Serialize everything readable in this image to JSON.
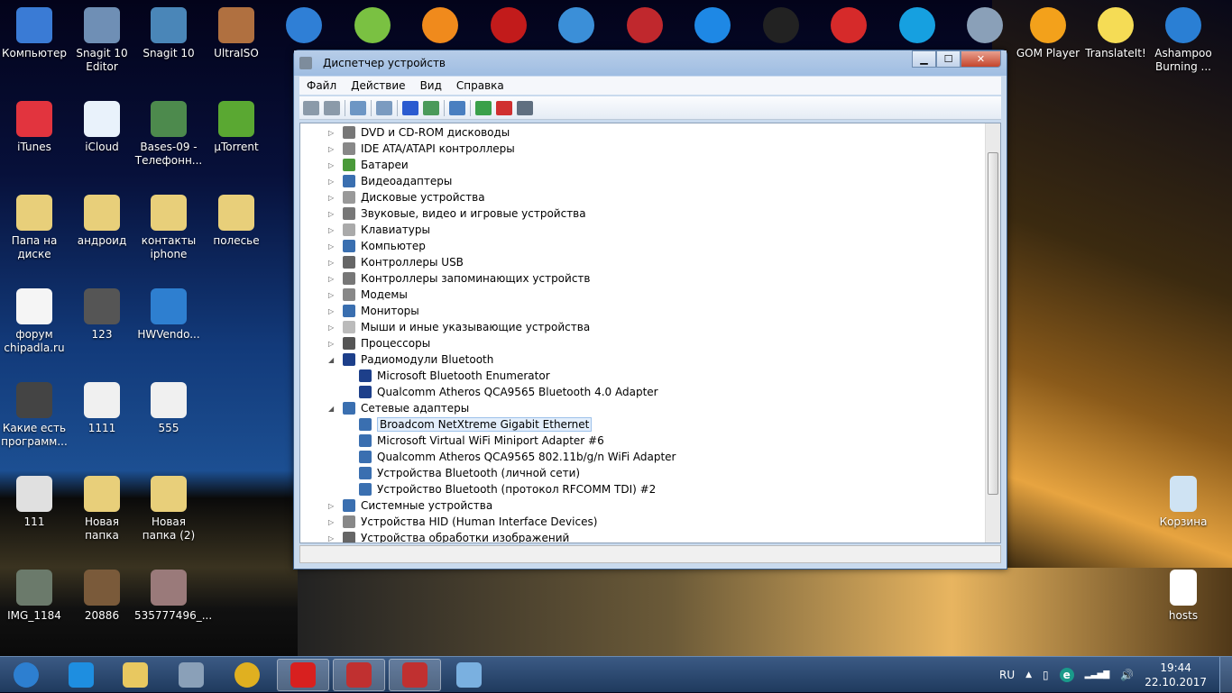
{
  "desktop": {
    "icons": [
      {
        "label": "Компьютер",
        "color": "#3a7bd5",
        "col": 0,
        "row": 0
      },
      {
        "label": "Snagit 10 Editor",
        "color": "#6f8fb5",
        "col": 1,
        "row": 0
      },
      {
        "label": "Snagit 10",
        "color": "#4a86b8",
        "col": 2,
        "row": 0
      },
      {
        "label": "UltraISO",
        "color": "#b07040",
        "col": 3,
        "row": 0
      },
      {
        "label": "iTunes",
        "color": "#e2343e",
        "col": 0,
        "row": 1
      },
      {
        "label": "iCloud",
        "color": "#e9f2fb",
        "col": 1,
        "row": 1
      },
      {
        "label": "Bases-09 - Телефонн...",
        "color": "#4d8a4d",
        "col": 2,
        "row": 1
      },
      {
        "label": "µTorrent",
        "color": "#5aa832",
        "col": 3,
        "row": 1
      },
      {
        "label": "Папа на диске",
        "color": "#e8cf7a",
        "col": 0,
        "row": 2
      },
      {
        "label": "андроид",
        "color": "#e8cf7a",
        "col": 1,
        "row": 2
      },
      {
        "label": "контакты iphone",
        "color": "#e8cf7a",
        "col": 2,
        "row": 2
      },
      {
        "label": "полесье",
        "color": "#e8cf7a",
        "col": 3,
        "row": 2
      },
      {
        "label": "форум chipadla.ru",
        "color": "#f5f5f5",
        "col": 0,
        "row": 3
      },
      {
        "label": "123",
        "color": "#555",
        "col": 1,
        "row": 3
      },
      {
        "label": "HWVendo...",
        "color": "#2e7fd0",
        "col": 2,
        "row": 3
      },
      {
        "label": "Какие есть программ...",
        "color": "#444",
        "col": 0,
        "row": 4
      },
      {
        "label": "1111",
        "color": "#f0f0f0",
        "col": 1,
        "row": 4
      },
      {
        "label": "555",
        "color": "#f0f0f0",
        "col": 2,
        "row": 4
      },
      {
        "label": "111",
        "color": "#e0e0e0",
        "col": 0,
        "row": 5
      },
      {
        "label": "Новая папка",
        "color": "#e8cf7a",
        "col": 1,
        "row": 5
      },
      {
        "label": "Новая папка (2)",
        "color": "#e8cf7a",
        "col": 2,
        "row": 5
      },
      {
        "label": "IMG_1184",
        "color": "#6b7a6b",
        "col": 0,
        "row": 6
      },
      {
        "label": "20886",
        "color": "#7a5a3a",
        "col": 1,
        "row": 6
      },
      {
        "label": "535777496_...",
        "color": "#9a7a7a",
        "col": 2,
        "row": 6
      }
    ],
    "top_hidden_icons": [
      {
        "color": "#2f7fd6"
      },
      {
        "color": "#7ac142"
      },
      {
        "color": "#f08a1c"
      },
      {
        "color": "#c21b1b"
      },
      {
        "color": "#3b8fd8"
      },
      {
        "color": "#c0282d"
      },
      {
        "color": "#1e88e5"
      },
      {
        "color": "#222"
      },
      {
        "color": "#d62a2a"
      },
      {
        "color": "#16a0e0"
      },
      {
        "color": "#8aa0b8"
      }
    ],
    "right_icons": [
      {
        "label": "GOM Player",
        "color": "#f3a11b"
      },
      {
        "label": "TranslateIt!",
        "color": "#f5dc55"
      },
      {
        "label": "Ashampoo Burning ...",
        "color": "#2a7fd4"
      }
    ],
    "right_bottom_icons": [
      {
        "label": "Корзина",
        "color": "#cfe3f3"
      },
      {
        "label": "hosts",
        "color": "#ffffff"
      }
    ]
  },
  "window": {
    "title": "Диспетчер устройств",
    "controls": {
      "minimize": "▁",
      "maximize": "☐",
      "close": "✕"
    },
    "menu": [
      "Файл",
      "Действие",
      "Вид",
      "Справка"
    ],
    "toolbar": [
      [
        "back",
        "#8b9aa9"
      ],
      [
        "forward",
        "#8b9aa9"
      ],
      [
        "sep"
      ],
      [
        "show-hide-console-tree",
        "#6d96c4"
      ],
      [
        "sep"
      ],
      [
        "properties",
        "#7b9bc0"
      ],
      [
        "sep"
      ],
      [
        "help",
        "#2b5bd0"
      ],
      [
        "action-pane",
        "#4a9a5a"
      ],
      [
        "sep"
      ],
      [
        "scan-hardware",
        "#4a7fc0"
      ],
      [
        "sep"
      ],
      [
        "update-driver",
        "#3aa04a"
      ],
      [
        "disable-device",
        "#d03030"
      ],
      [
        "uninstall-device",
        "#606f80"
      ]
    ],
    "tree": [
      {
        "label": "DVD и CD-ROM дисководы",
        "level": 0,
        "expander": "▷",
        "icon": "#777"
      },
      {
        "label": "IDE ATA/ATAPI контроллеры",
        "level": 0,
        "expander": "▷",
        "icon": "#888"
      },
      {
        "label": "Батареи",
        "level": 0,
        "expander": "▷",
        "icon": "#4a9a3a"
      },
      {
        "label": "Видеоадаптеры",
        "level": 0,
        "expander": "▷",
        "icon": "#3a6fb0"
      },
      {
        "label": "Дисковые устройства",
        "level": 0,
        "expander": "▷",
        "icon": "#999"
      },
      {
        "label": "Звуковые, видео и игровые устройства",
        "level": 0,
        "expander": "▷",
        "icon": "#777"
      },
      {
        "label": "Клавиатуры",
        "level": 0,
        "expander": "▷",
        "icon": "#aaa"
      },
      {
        "label": "Компьютер",
        "level": 0,
        "expander": "▷",
        "icon": "#3a6fb0"
      },
      {
        "label": "Контроллеры USB",
        "level": 0,
        "expander": "▷",
        "icon": "#666"
      },
      {
        "label": "Контроллеры запоминающих устройств",
        "level": 0,
        "expander": "▷",
        "icon": "#777"
      },
      {
        "label": "Модемы",
        "level": 0,
        "expander": "▷",
        "icon": "#888"
      },
      {
        "label": "Мониторы",
        "level": 0,
        "expander": "▷",
        "icon": "#3a6fb0"
      },
      {
        "label": "Мыши и иные указывающие устройства",
        "level": 0,
        "expander": "▷",
        "icon": "#bbb"
      },
      {
        "label": "Процессоры",
        "level": 0,
        "expander": "▷",
        "icon": "#555"
      },
      {
        "label": "Радиомодули Bluetooth",
        "level": 0,
        "expander": "◢",
        "icon": "#1d3f8a"
      },
      {
        "label": "Microsoft Bluetooth Enumerator",
        "level": 1,
        "icon": "#1d3f8a"
      },
      {
        "label": "Qualcomm Atheros QCA9565 Bluetooth 4.0 Adapter",
        "level": 1,
        "icon": "#1d3f8a"
      },
      {
        "label": "Сетевые адаптеры",
        "level": 0,
        "expander": "◢",
        "icon": "#3a6fb0"
      },
      {
        "label": "Broadcom NetXtreme Gigabit Ethernet",
        "level": 1,
        "icon": "#3a6fb0",
        "selected": true
      },
      {
        "label": "Microsoft Virtual WiFi Miniport Adapter #6",
        "level": 1,
        "icon": "#3a6fb0"
      },
      {
        "label": "Qualcomm Atheros QCA9565 802.11b/g/n WiFi Adapter",
        "level": 1,
        "icon": "#3a6fb0"
      },
      {
        "label": "Устройства Bluetooth (личной сети)",
        "level": 1,
        "icon": "#3a6fb0"
      },
      {
        "label": "Устройство Bluetooth (протокол RFCOMM TDI) #2",
        "level": 1,
        "icon": "#3a6fb0"
      },
      {
        "label": "Системные устройства",
        "level": 0,
        "expander": "▷",
        "icon": "#3a6fb0"
      },
      {
        "label": "Устройства HID (Human Interface Devices)",
        "level": 0,
        "expander": "▷",
        "icon": "#888"
      },
      {
        "label": "Устройства обработки изображений",
        "level": 0,
        "expander": "▷",
        "icon": "#666"
      }
    ]
  },
  "taskbar": {
    "items": [
      [
        "start-button",
        "#2d7fd0",
        false
      ],
      [
        "internet-explorer",
        "#1e8ee0",
        false
      ],
      [
        "windows-explorer",
        "#e8c860",
        false
      ],
      [
        "calculator",
        "#8aa0b8",
        false
      ],
      [
        "chrome",
        "#e0b020",
        false
      ],
      [
        "opera",
        "#d8201f",
        true
      ],
      [
        "device-manager",
        "#c03030",
        true
      ],
      [
        "device-manager-2",
        "#c03030",
        true
      ],
      [
        "paint",
        "#7ab0e0",
        false
      ]
    ],
    "tray": {
      "language": "RU",
      "show_hidden": "▲",
      "battery": "▯",
      "eset": "e",
      "signal": "▂▃▅▇",
      "volume": "🔊",
      "time": "19:44",
      "date": "22.10.2017"
    }
  }
}
